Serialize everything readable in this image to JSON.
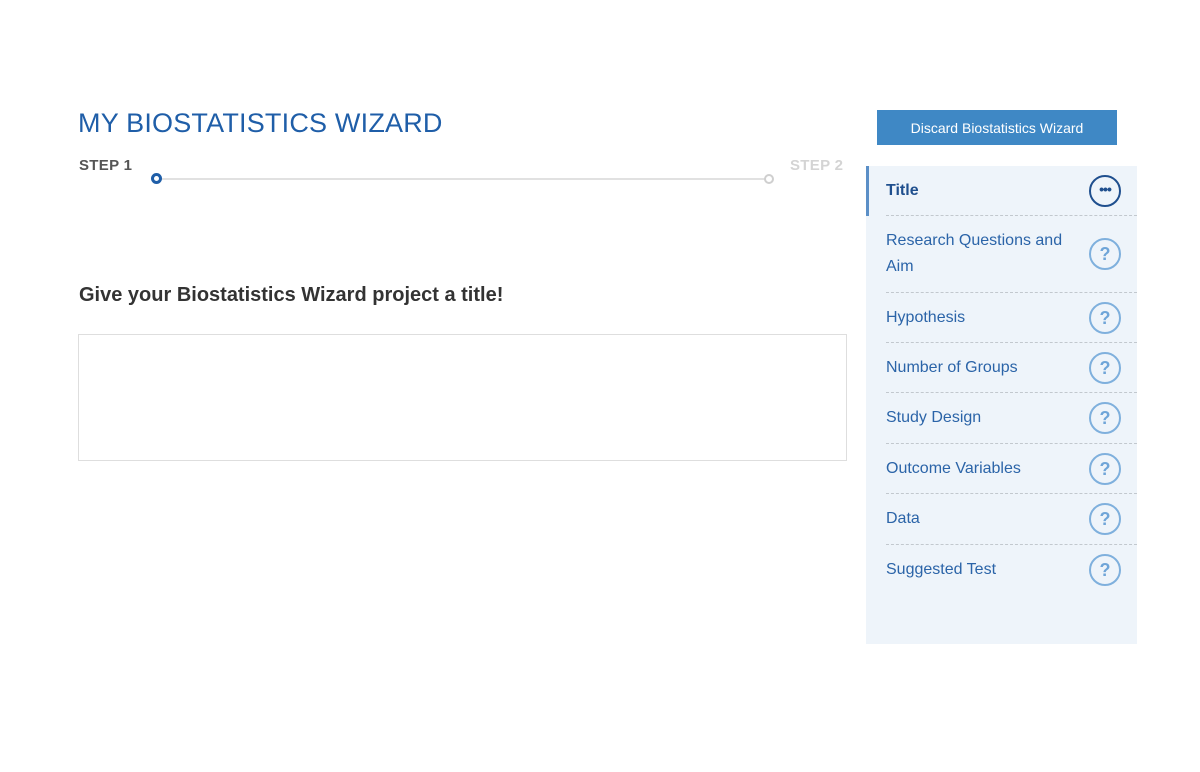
{
  "wizard": {
    "title": "MY BIOSTATISTICS WIZARD",
    "steps": [
      {
        "label": "STEP 1",
        "state": "active"
      },
      {
        "label": "STEP 2",
        "state": "inactive"
      }
    ],
    "question": "Give your Biostatistics Wizard project a title!",
    "title_input": {
      "value": "",
      "placeholder": ""
    }
  },
  "sidebar": {
    "discard_label": "Discard Biostatistics Wizard",
    "items": [
      {
        "label": "Title",
        "icon": "more-icon",
        "glyph": "•••",
        "active": true
      },
      {
        "label": "Research Questions and Aim",
        "icon": "help-icon",
        "glyph": "?",
        "active": false
      },
      {
        "label": "Hypothesis",
        "icon": "help-icon",
        "glyph": "?",
        "active": false
      },
      {
        "label": "Number of Groups",
        "icon": "help-icon",
        "glyph": "?",
        "active": false
      },
      {
        "label": "Study Design",
        "icon": "help-icon",
        "glyph": "?",
        "active": false
      },
      {
        "label": "Outcome Variables",
        "icon": "help-icon",
        "glyph": "?",
        "active": false
      },
      {
        "label": "Data",
        "icon": "help-icon",
        "glyph": "?",
        "active": false
      },
      {
        "label": "Suggested Test",
        "icon": "help-icon",
        "glyph": "?",
        "active": false
      }
    ]
  },
  "colors": {
    "title_blue": "#1f5ea8",
    "button_blue": "#3f88c5",
    "sidebar_bg": "#eef4fa",
    "nav_text": "#2b64a8",
    "icon_ring": "#7fb0dd"
  }
}
